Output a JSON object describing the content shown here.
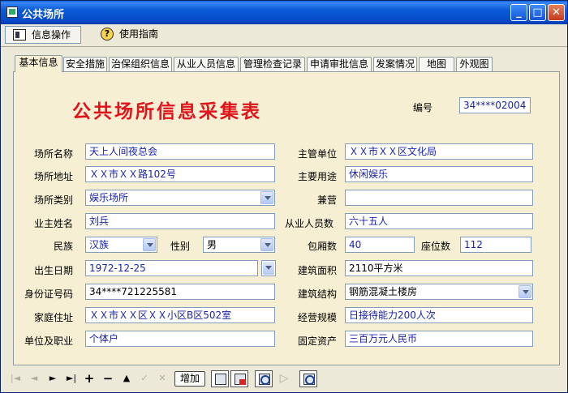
{
  "window": {
    "title": "公共场所"
  },
  "toolbar": {
    "info_ops": "信息操作",
    "help": "使用指南"
  },
  "tabs": [
    "基本信息",
    "安全措施",
    "治保组织信息",
    "从业人员信息",
    "管理检查记录",
    "申请审批信息",
    "发案情况",
    "地图",
    "外观图"
  ],
  "form": {
    "heading": "公共场所信息采集表",
    "labels": {
      "serial": "编号",
      "name": "场所名称",
      "address": "场所地址",
      "category": "场所类别",
      "owner": "业主姓名",
      "ethnicity": "民族",
      "gender": "性别",
      "birth_date": "出生日期",
      "id_number": "身份证号码",
      "home_address": "家庭住址",
      "work_unit": "单位及职业",
      "authority": "主管单位",
      "main_use": "主要用途",
      "concurrent": "兼营",
      "staff_count": "从业人员数",
      "room_count": "包厢数",
      "seat_count": "座位数",
      "floor_area": "建筑面积",
      "structure": "建筑结构",
      "scale": "经营规模",
      "fixed_assets": "固定资产"
    },
    "values": {
      "serial": "34****02004",
      "name": "天上人间夜总会",
      "address": "ＸＸ市ＸＸ路102号",
      "category": "娱乐场所",
      "owner": "刘兵",
      "ethnicity": "汉族",
      "gender": "男",
      "birth_date": "1972-12-25",
      "id_number": "34****721225581",
      "home_address": "ＸＸ市ＸＸ区ＸＸ小区B区502室",
      "work_unit": "个体户",
      "authority": "ＸＸ市ＸＸ区文化局",
      "main_use": "休闲娱乐",
      "concurrent": "",
      "staff_count": "六十五人",
      "room_count": "40",
      "seat_count": "112",
      "floor_area": "2110平方米",
      "structure": "钢筋混凝土楼房",
      "scale": "日接待能力200人次",
      "fixed_assets": "三百万元人民币"
    }
  },
  "navbar": {
    "first": "|◄",
    "prev": "◄",
    "next": "►",
    "last": "►|",
    "add_sym": "+",
    "remove_sym": "−",
    "up_sym": "▲",
    "check_sym": "✓",
    "cancel_sym": "✕",
    "add_button": "增加"
  },
  "colors": {
    "panel_bg": "#f6efd3",
    "heading": "#e0151c",
    "field_text": "#1a23a8"
  }
}
